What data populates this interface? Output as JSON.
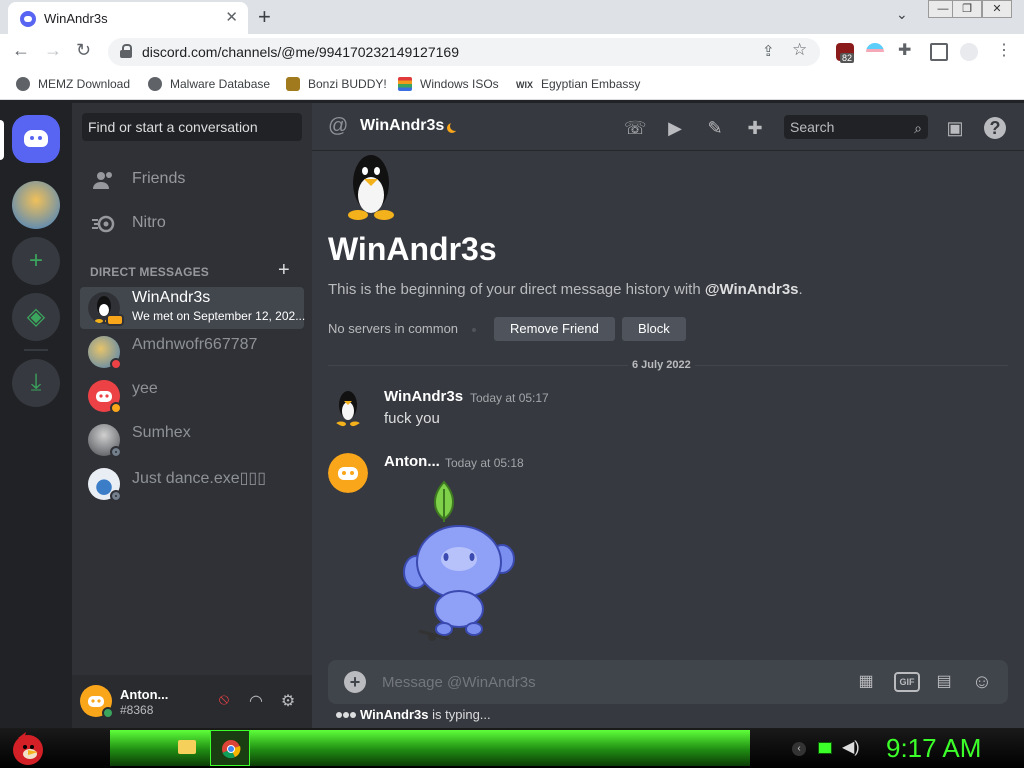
{
  "browser": {
    "tab_title": "WinAndr3s",
    "tab_close": "✕",
    "new_tab": "+",
    "url": "discord.com/channels/@me/994170232149127169",
    "extension_badge": "82",
    "window_buttons": [
      "—",
      "❐",
      "✕"
    ],
    "bookmarks": [
      {
        "label": "MEMZ Download",
        "icon": "globe-icon",
        "color": "#3c4043"
      },
      {
        "label": "Malware Database",
        "icon": "globe-icon",
        "color": "#3c4043"
      },
      {
        "label": "Bonzi BUDDY!",
        "icon": "bonzi-icon",
        "color": "#a07a1c"
      },
      {
        "label": "Windows ISOs",
        "icon": "windows-flag-icon",
        "color": "#e03a3a"
      },
      {
        "label": "Egyptian Embassy",
        "icon": "wix-icon",
        "color": "#000000"
      }
    ],
    "bookmark_prefix_wix": "WIX"
  },
  "discord": {
    "finder_placeholder": "Find or start a conversation",
    "nav": [
      {
        "label": "Friends",
        "icon": "friends-icon"
      },
      {
        "label": "Nitro",
        "icon": "nitro-icon"
      }
    ],
    "dm_header": "DIRECT MESSAGES",
    "dm_add": "+",
    "dms": [
      {
        "name": "WinAndr3s",
        "subtext": "We met on September 12, 202...",
        "status": "mobile",
        "avatar_color": "#f2f3f5",
        "status_color": "#faa61a"
      },
      {
        "name": "Amdnwofr667787",
        "subtext": "",
        "status": "dnd",
        "avatar_color": "#e6c46b",
        "status_color": "#ed4245"
      },
      {
        "name": "yee",
        "subtext": "",
        "status": "idle",
        "avatar_color": "#ed4245",
        "status_color": "#faa61a"
      },
      {
        "name": "Sumhex",
        "subtext": "",
        "status": "offline",
        "avatar_color": "#6a6e75",
        "status_color": "#747f8d"
      },
      {
        "name": "Just dance.exe▯▯▯",
        "subtext": "",
        "status": "offline",
        "avatar_color": "#e9eef5",
        "status_color": "#747f8d"
      }
    ],
    "user": {
      "name": "Anton...",
      "tag": "#8368",
      "status_color": "#3ba55d"
    },
    "header": {
      "at_symbol": "@",
      "channel_name": "WinAndr3s",
      "search_placeholder": "Search"
    },
    "intro": {
      "title": "WinAndr3s",
      "text_prefix": "This is the beginning of your direct message history with ",
      "text_handle": "@WinAndr3s",
      "text_suffix": ".",
      "no_servers": "No servers in common",
      "remove_friend": "Remove Friend",
      "block": "Block"
    },
    "date_divider": "6 July 2022",
    "messages": [
      {
        "author": "WinAndr3s",
        "time": "Today at 05:17",
        "text": "fuck you",
        "avatar": "penguin-avatar"
      },
      {
        "author": "Anton...",
        "time": "Today at 05:18",
        "text": "",
        "avatar": "discord-default-avatar",
        "attachment": "wumpus-sticker"
      }
    ],
    "composer_placeholder": "Message @WinAndr3s",
    "typing_user": "WinAndr3s",
    "typing_suffix": " is typing..."
  },
  "taskbar": {
    "clock": "9:17 AM"
  },
  "colors": {
    "blurple": "#5865f2",
    "green": "#3ba55d",
    "taskbar_green": "#3cff2a"
  }
}
